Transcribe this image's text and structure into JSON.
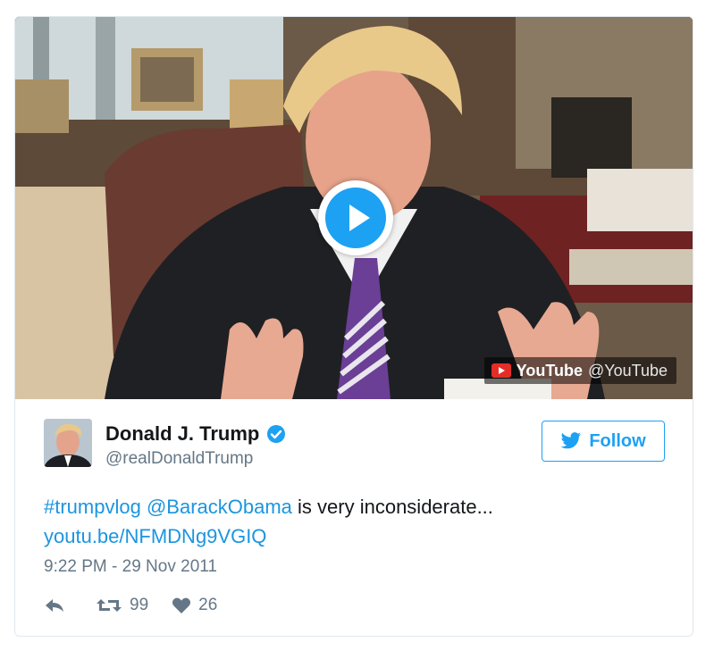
{
  "media": {
    "youtube_word": "YouTube",
    "youtube_handle": "@YouTube"
  },
  "tweet": {
    "author_name": "Donald J. Trump",
    "author_handle": "@realDonaldTrump",
    "follow_label": "Follow",
    "hashtag": "#trumpvlog",
    "mention": "@BarackObama",
    "text_rest": " is very inconsiderate...",
    "link": "youtu.be/NFMDNg9VGIQ",
    "timestamp": "9:22 PM - 29 Nov 2011",
    "retweets": "99",
    "likes": "26"
  },
  "colors": {
    "accent": "#1da1f2",
    "link": "#1b95e0",
    "muted": "#657786",
    "border": "#e1e8ed",
    "youtube_red": "#e52d27"
  },
  "icons": [
    "play-icon",
    "youtube-icon",
    "verified-icon",
    "twitter-bird-icon",
    "reply-icon",
    "retweet-icon",
    "heart-icon"
  ]
}
